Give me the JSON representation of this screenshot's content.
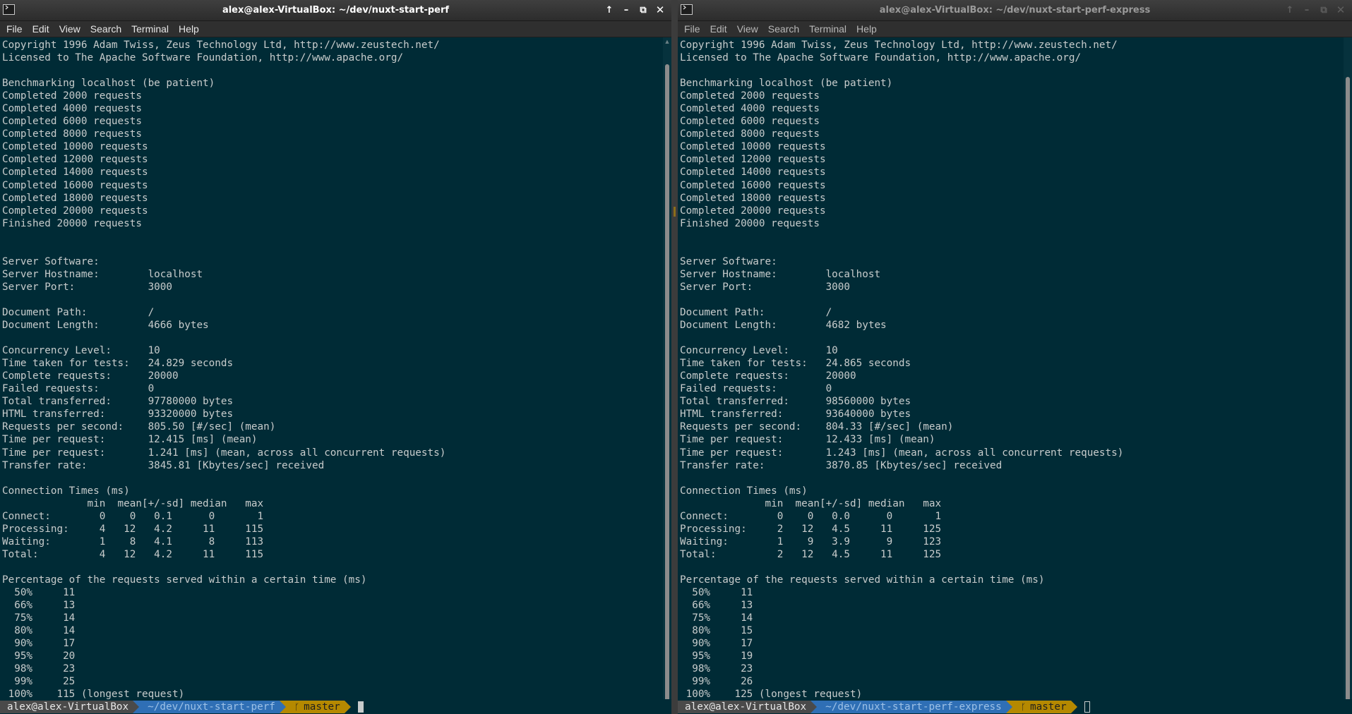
{
  "windows": [
    {
      "id": "left",
      "title": "alex@alex-VirtualBox: ~/dev/nuxt-start-perf",
      "active": true,
      "menu": [
        "File",
        "Edit",
        "View",
        "Search",
        "Terminal",
        "Help"
      ],
      "controls": {
        "up": "↑",
        "minimize": "–",
        "maximize": "⧉",
        "close": "✕"
      },
      "icon": "terminal-icon",
      "output_lines": [
        "Copyright 1996 Adam Twiss, Zeus Technology Ltd, http://www.zeustech.net/",
        "Licensed to The Apache Software Foundation, http://www.apache.org/",
        "",
        "Benchmarking localhost (be patient)",
        "Completed 2000 requests",
        "Completed 4000 requests",
        "Completed 6000 requests",
        "Completed 8000 requests",
        "Completed 10000 requests",
        "Completed 12000 requests",
        "Completed 14000 requests",
        "Completed 16000 requests",
        "Completed 18000 requests",
        "Completed 20000 requests",
        "Finished 20000 requests",
        "",
        "",
        "Server Software:",
        "Server Hostname:        localhost",
        "Server Port:            3000",
        "",
        "Document Path:          /",
        "Document Length:        4666 bytes",
        "",
        "Concurrency Level:      10",
        "Time taken for tests:   24.829 seconds",
        "Complete requests:      20000",
        "Failed requests:        0",
        "Total transferred:      97780000 bytes",
        "HTML transferred:       93320000 bytes",
        "Requests per second:    805.50 [#/sec] (mean)",
        "Time per request:       12.415 [ms] (mean)",
        "Time per request:       1.241 [ms] (mean, across all concurrent requests)",
        "Transfer rate:          3845.81 [Kbytes/sec] received",
        "",
        "Connection Times (ms)",
        "              min  mean[+/-sd] median   max",
        "Connect:        0    0   0.1      0       1",
        "Processing:     4   12   4.2     11     115",
        "Waiting:        1    8   4.1      8     113",
        "Total:          4   12   4.2     11     115",
        "",
        "Percentage of the requests served within a certain time (ms)",
        "  50%     11",
        "  66%     13",
        "  75%     14",
        "  80%     14",
        "  90%     17",
        "  95%     20",
        "  98%     23",
        "  99%     25",
        " 100%    115 (longest request)"
      ],
      "prompt": {
        "user": "alex@alex-VirtualBox",
        "path": "~/dev/nuxt-start-perf",
        "branch_icon": "ᚴ",
        "branch": "master"
      }
    },
    {
      "id": "right",
      "title": "alex@alex-VirtualBox: ~/dev/nuxt-start-perf-express",
      "active": false,
      "menu": [
        "File",
        "Edit",
        "View",
        "Search",
        "Terminal",
        "Help"
      ],
      "controls": {
        "up": "↑",
        "minimize": "–",
        "maximize": "⧉",
        "close": "✕"
      },
      "icon": "terminal-icon",
      "output_lines": [
        "Copyright 1996 Adam Twiss, Zeus Technology Ltd, http://www.zeustech.net/",
        "Licensed to The Apache Software Foundation, http://www.apache.org/",
        "",
        "Benchmarking localhost (be patient)",
        "Completed 2000 requests",
        "Completed 4000 requests",
        "Completed 6000 requests",
        "Completed 8000 requests",
        "Completed 10000 requests",
        "Completed 12000 requests",
        "Completed 14000 requests",
        "Completed 16000 requests",
        "Completed 18000 requests",
        "Completed 20000 requests",
        "Finished 20000 requests",
        "",
        "",
        "Server Software:",
        "Server Hostname:        localhost",
        "Server Port:            3000",
        "",
        "Document Path:          /",
        "Document Length:        4682 bytes",
        "",
        "Concurrency Level:      10",
        "Time taken for tests:   24.865 seconds",
        "Complete requests:      20000",
        "Failed requests:        0",
        "Total transferred:      98560000 bytes",
        "HTML transferred:       93640000 bytes",
        "Requests per second:    804.33 [#/sec] (mean)",
        "Time per request:       12.433 [ms] (mean)",
        "Time per request:       1.243 [ms] (mean, across all concurrent requests)",
        "Transfer rate:          3870.85 [Kbytes/sec] received",
        "",
        "Connection Times (ms)",
        "              min  mean[+/-sd] median   max",
        "Connect:        0    0   0.0      0       1",
        "Processing:     2   12   4.5     11     125",
        "Waiting:        1    9   3.9      9     123",
        "Total:          2   12   4.5     11     125",
        "",
        "Percentage of the requests served within a certain time (ms)",
        "  50%     11",
        "  66%     13",
        "  75%     14",
        "  80%     15",
        "  90%     17",
        "  95%     19",
        "  98%     23",
        "  99%     26",
        " 100%    125 (longest request)"
      ],
      "prompt": {
        "user": "alex@alex-VirtualBox",
        "path": "~/dev/nuxt-start-perf-express",
        "branch_icon": "ᚴ",
        "branch": "master"
      }
    }
  ]
}
